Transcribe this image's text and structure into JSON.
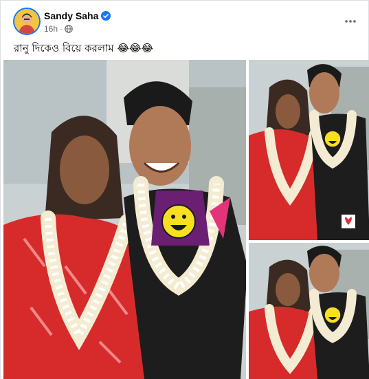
{
  "post": {
    "author": "Sandy Saha",
    "verified": true,
    "time": "16h",
    "separator": "·",
    "audience_icon": "globe-icon",
    "caption": "রানু দিকেও বিয়ে করলাম 😂😂😂",
    "more_icon": "more-options-icon"
  },
  "photos": [
    {
      "alt": "main-photo"
    },
    {
      "alt": "side-photo-top"
    },
    {
      "alt": "side-photo-bottom"
    }
  ],
  "colors": {
    "accent": "#1877f2",
    "text": "#050505",
    "muted": "#65676b",
    "border": "#dddfe2"
  }
}
